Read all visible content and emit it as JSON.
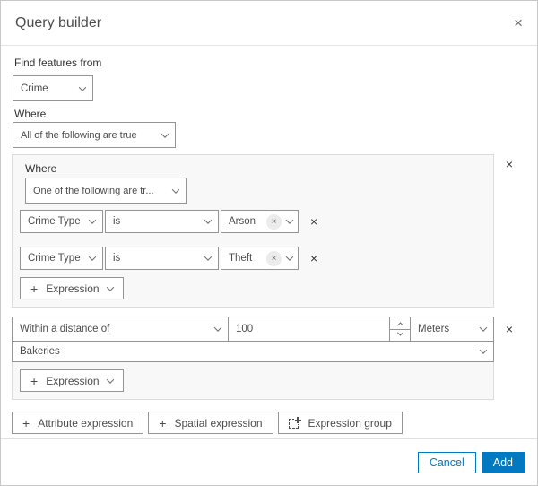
{
  "colors": {
    "accent": "#0079c1",
    "panel_bg": "#f8f8f8",
    "control_border": "#949494"
  },
  "icons": {
    "plus": "+",
    "close": "×"
  },
  "dialog": {
    "title": "Query builder"
  },
  "find": {
    "label": "Find features from",
    "value": "Crime"
  },
  "where": {
    "label": "Where",
    "value": "All of the following are true"
  },
  "group1": {
    "label": "Where",
    "operator": "One of the following are tr...",
    "rows": [
      {
        "field": "Crime Type",
        "op": "is",
        "value": "Arson"
      },
      {
        "field": "Crime Type",
        "op": "is",
        "value": "Theft"
      }
    ],
    "add_label": "Expression"
  },
  "group2": {
    "operator": "Within a distance of",
    "distance": "100",
    "units": "Meters",
    "layer": "Bakeries",
    "add_label": "Expression"
  },
  "actions": {
    "attribute": "Attribute expression",
    "spatial": "Spatial expression",
    "group": "Expression group"
  },
  "footer": {
    "cancel": "Cancel",
    "add": "Add"
  }
}
